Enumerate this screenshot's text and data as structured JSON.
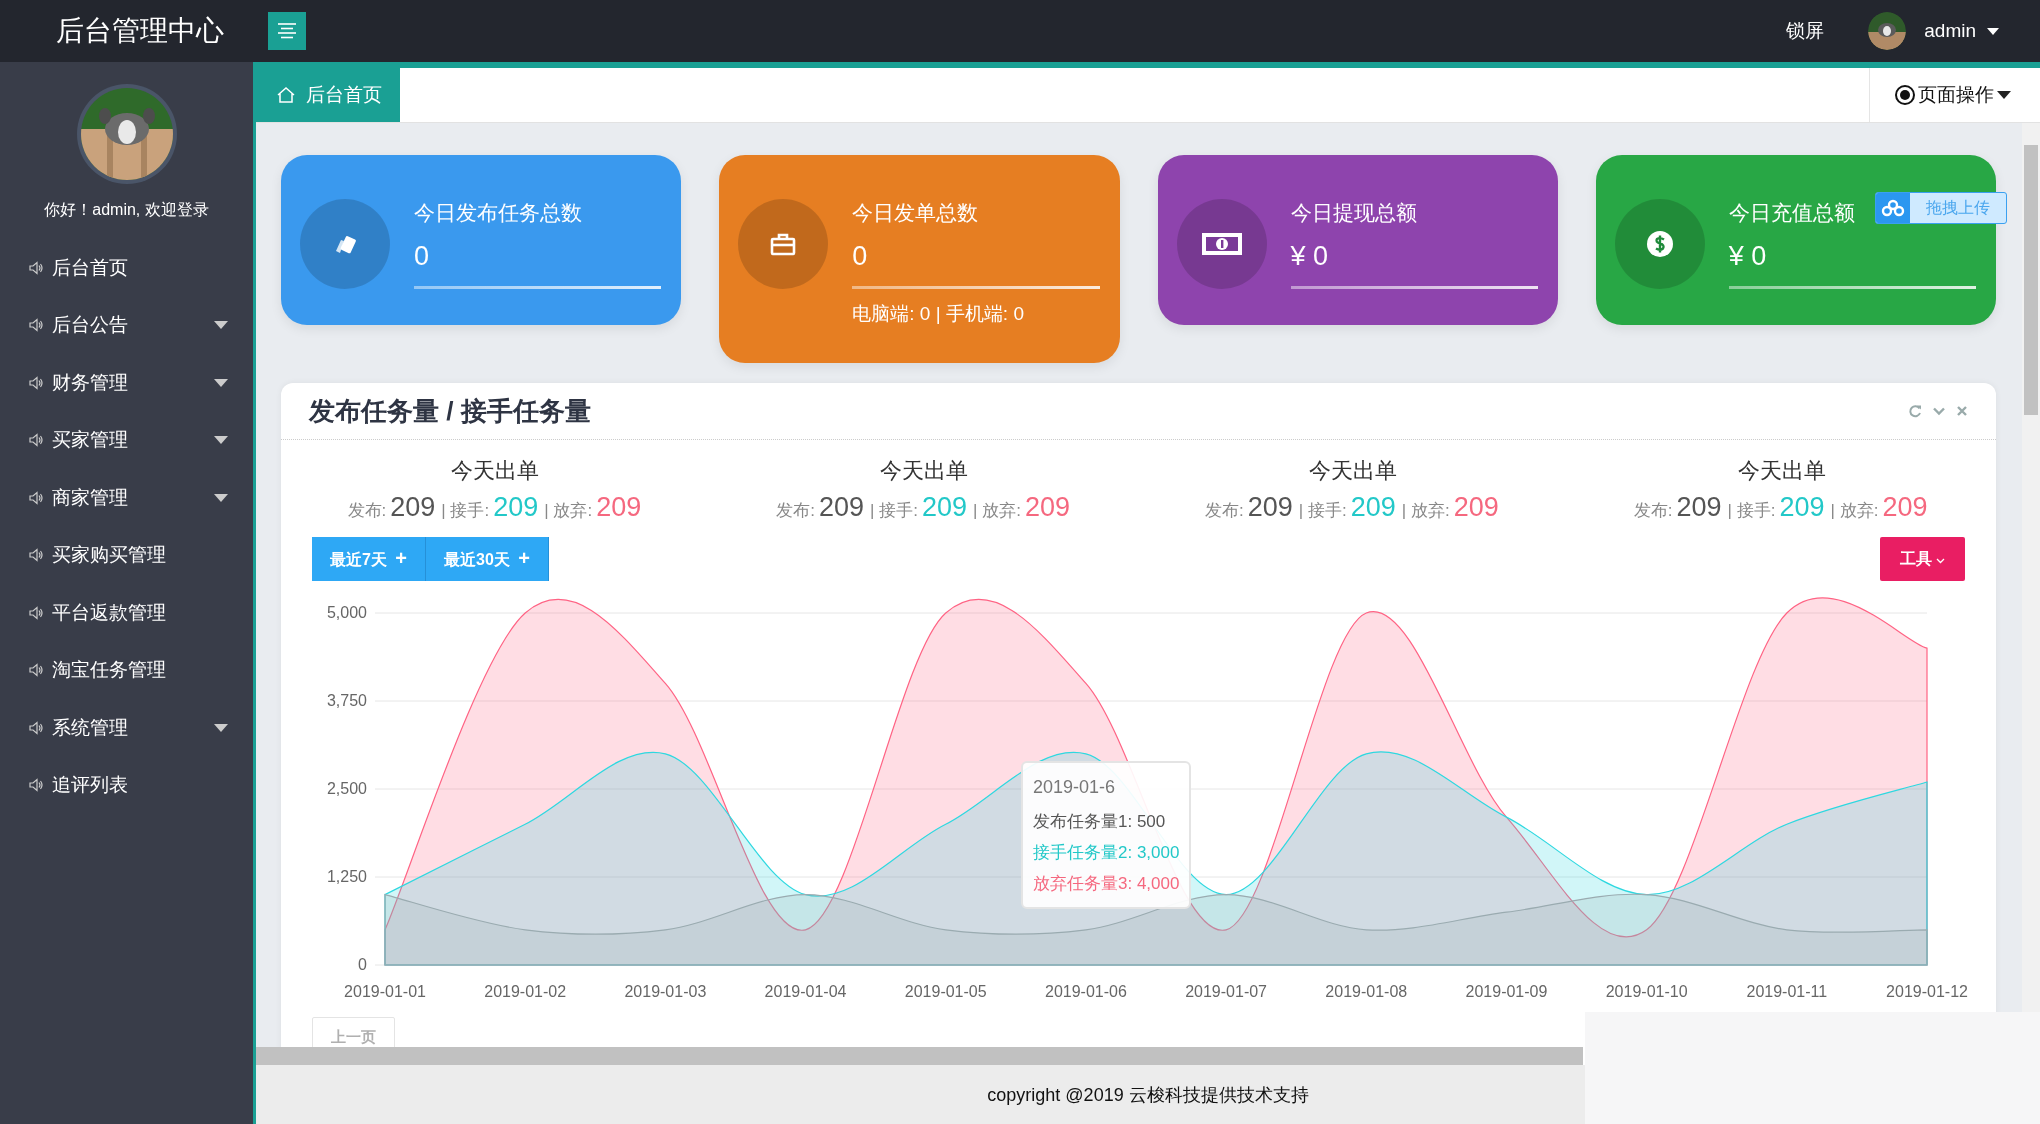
{
  "topbar": {
    "title": "后台管理中心",
    "lock": "锁屏",
    "user": "admin"
  },
  "sidebar": {
    "welcome": "你好！admin, 欢迎登录",
    "items": [
      {
        "label": "后台首页",
        "has_submenu": false
      },
      {
        "label": "后台公告",
        "has_submenu": true
      },
      {
        "label": "财务管理",
        "has_submenu": true
      },
      {
        "label": "买家管理",
        "has_submenu": true
      },
      {
        "label": "商家管理",
        "has_submenu": true
      },
      {
        "label": "买家购买管理",
        "has_submenu": false
      },
      {
        "label": "平台返款管理",
        "has_submenu": false
      },
      {
        "label": "淘宝任务管理",
        "has_submenu": false
      },
      {
        "label": "系统管理",
        "has_submenu": true
      },
      {
        "label": "追评列表",
        "has_submenu": false
      }
    ]
  },
  "tabs": [
    {
      "label": "后台首页",
      "selected": true
    }
  ],
  "page_actions": "页面操作",
  "cards": [
    {
      "kind": "cards",
      "title": "今日发布任务总数",
      "value": "0",
      "color": "#3a99ee"
    },
    {
      "kind": "briefcase",
      "title": "今日发单总数",
      "value": "0",
      "detail": "电脑端: 0 | 手机端: 0",
      "color": "#e67e22"
    },
    {
      "kind": "banknote",
      "title": "今日提现总额",
      "value": "¥ 0",
      "color": "#8e44ad"
    },
    {
      "kind": "dollar",
      "title": "今日充值总额",
      "value": "¥ 0",
      "color": "#28a745"
    }
  ],
  "upload_badge": "拖拽上传",
  "panel": {
    "title": "发布任务量 / 接手任务量",
    "stats": [
      {
        "title": "今天出单",
        "items": [
          {
            "kind": "publish",
            "label": "发布:",
            "value": "209"
          },
          {
            "kind": "accept",
            "label": "| 接手:",
            "value": "209"
          },
          {
            "kind": "abandon",
            "label": "| 放弃:",
            "value": "209"
          }
        ]
      },
      {
        "title": "今天出单",
        "items": [
          {
            "kind": "publish",
            "label": "发布:",
            "value": "209"
          },
          {
            "kind": "accept",
            "label": "| 接手:",
            "value": "209"
          },
          {
            "kind": "abandon",
            "label": "| 放弃:",
            "value": "209"
          }
        ]
      },
      {
        "title": "今天出单",
        "items": [
          {
            "kind": "publish",
            "label": "发布:",
            "value": "209"
          },
          {
            "kind": "accept",
            "label": "| 接手:",
            "value": "209"
          },
          {
            "kind": "abandon",
            "label": "| 放弃:",
            "value": "209"
          }
        ]
      },
      {
        "title": "今天出单",
        "items": [
          {
            "kind": "publish",
            "label": "发布:",
            "value": "209"
          },
          {
            "kind": "accept",
            "label": "| 接手:",
            "value": "209"
          },
          {
            "kind": "abandon",
            "label": "| 放弃:",
            "value": "209"
          }
        ]
      }
    ],
    "range_buttons": [
      {
        "label": "最近7天",
        "icon": "+"
      },
      {
        "label": "最近30天",
        "icon": "+"
      }
    ],
    "tools_button": "工具",
    "chart_data": {
      "type": "area",
      "categories": [
        "2019-01-01",
        "2019-01-02",
        "2019-01-03",
        "2019-01-04",
        "2019-01-05",
        "2019-01-06",
        "2019-01-07",
        "2019-01-08",
        "2019-01-09",
        "2019-01-10",
        "2019-01-11",
        "2019-01-12"
      ],
      "series": [
        {
          "name": "发布任务量1",
          "color": "#9aabb0",
          "values": [
            1000,
            500,
            500,
            1000,
            500,
            500,
            1000,
            500,
            750,
            1000,
            500,
            500
          ]
        },
        {
          "name": "接手任务量2",
          "color": "#2ed8e0",
          "values": [
            1000,
            2000,
            3000,
            1000,
            2000,
            3000,
            1000,
            3000,
            2100,
            1000,
            2000,
            2600
          ]
        },
        {
          "name": "放弃任务量3",
          "color": "#ff6384",
          "values": [
            500,
            5000,
            4000,
            500,
            5000,
            4000,
            500,
            5000,
            2100,
            500,
            5000,
            4500
          ]
        }
      ],
      "grid": true,
      "ylim": [
        0,
        5000
      ],
      "yticks": [
        {
          "value": 0,
          "label": "0"
        },
        {
          "value": 1250,
          "label": "1,250"
        },
        {
          "value": 2500,
          "label": "2,500"
        },
        {
          "value": 3750,
          "label": "3,750"
        },
        {
          "value": 5000,
          "label": "5,000"
        }
      ]
    },
    "tooltip": {
      "title": "2019-01-6",
      "lines": [
        {
          "kind": "publish",
          "value": ": 500"
        },
        {
          "kind": "accept",
          "value": ": 3,000"
        },
        {
          "kind": "abandon",
          "value": ": 4,000"
        }
      ]
    },
    "pager": {
      "label": "上一页",
      "disabled": true
    }
  },
  "footer": "copyright @2019 云梭科技提供技术支持"
}
